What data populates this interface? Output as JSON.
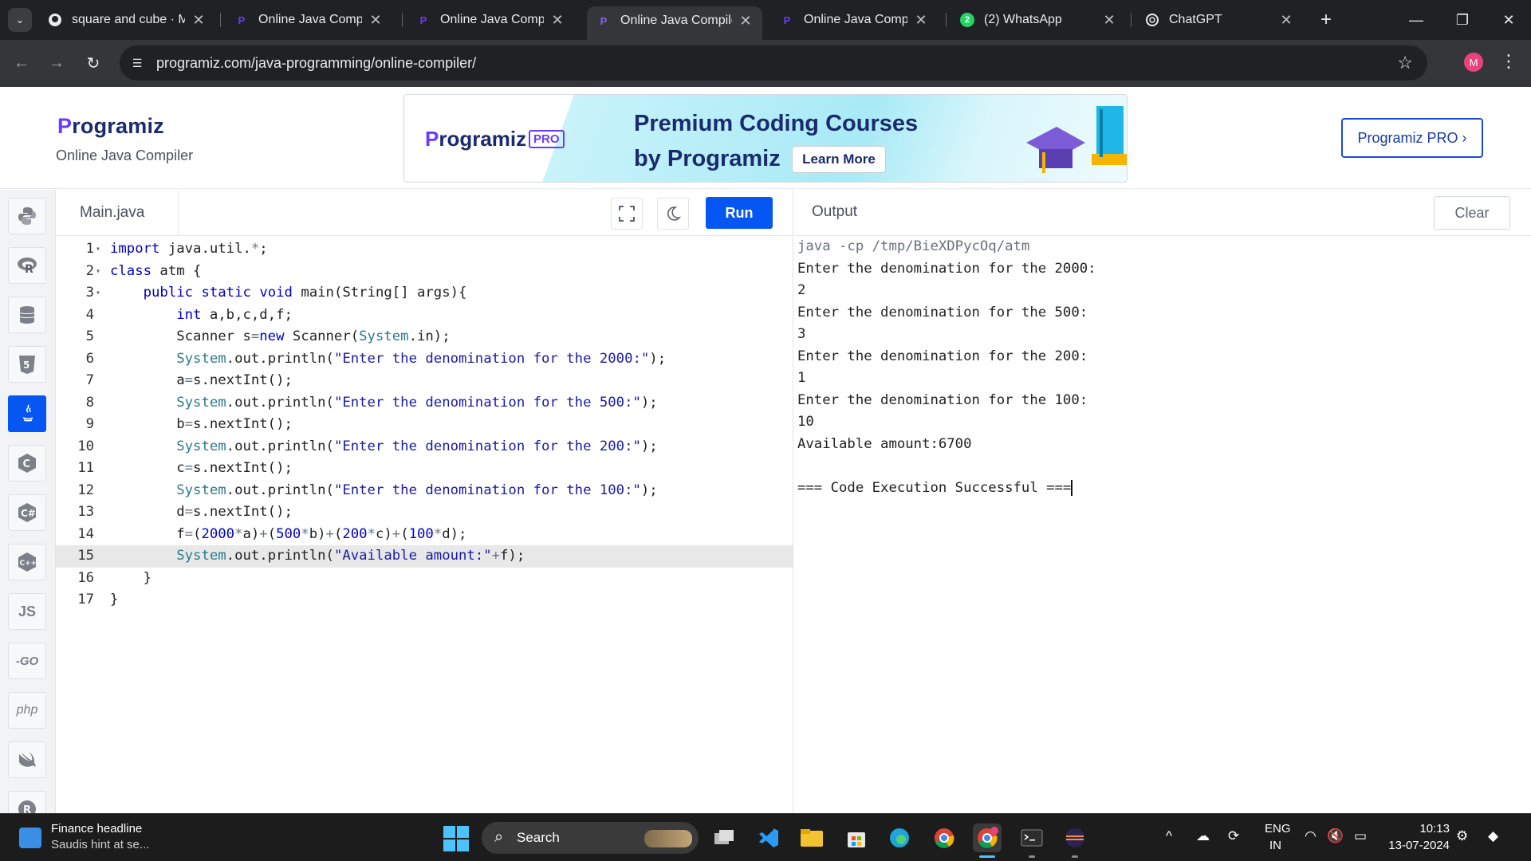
{
  "browser": {
    "tabs": [
      {
        "title": "square and cube · Mc",
        "favicon": "github-icon"
      },
      {
        "title": "Online Java Compiler",
        "favicon": "programiz-icon"
      },
      {
        "title": "Online Java Compiler",
        "favicon": "programiz-icon"
      },
      {
        "title": "Online Java Compiler",
        "favicon": "programiz-icon",
        "active": true
      },
      {
        "title": "Online Java Compiler",
        "favicon": "programiz-icon"
      },
      {
        "title": "(2) WhatsApp",
        "favicon": "whatsapp-icon",
        "badge": "2"
      },
      {
        "title": "ChatGPT",
        "favicon": "chatgpt-icon"
      }
    ],
    "url": "programiz.com/java-programming/online-compiler/",
    "profile_initial": "M"
  },
  "site": {
    "logo_p": "P",
    "logo_rest": "rogramiz",
    "subtitle": "Online Java Compiler",
    "banner": {
      "logo_p": "P",
      "logo_rest": "rogramiz",
      "pro_badge": "PRO",
      "line1": "Premium Coding Courses",
      "line2": "by Programiz",
      "cta": "Learn More"
    },
    "pro_button": "Programiz PRO ›"
  },
  "sidebar": {
    "languages": [
      {
        "name": "python-icon"
      },
      {
        "name": "r-icon"
      },
      {
        "name": "sql-icon"
      },
      {
        "name": "html-icon"
      },
      {
        "name": "java-icon",
        "active": true
      },
      {
        "name": "c-icon"
      },
      {
        "name": "csharp-icon"
      },
      {
        "name": "cpp-icon"
      },
      {
        "name": "js-icon",
        "label": "JS"
      },
      {
        "name": "go-icon",
        "label": "-GO"
      },
      {
        "name": "php-icon",
        "label": "php"
      },
      {
        "name": "swift-icon"
      },
      {
        "name": "rust-icon"
      }
    ]
  },
  "editor": {
    "file_tab": "Main.java",
    "run_label": "Run",
    "active_line": 15,
    "lines": [
      "import java.util.*;",
      "class atm {",
      "    public static void main(String[] args){",
      "        int a,b,c,d,f;",
      "        Scanner s=new Scanner(System.in);",
      "        System.out.println(\"Enter the denomination for the 2000:\");",
      "        a=s.nextInt();",
      "        System.out.println(\"Enter the denomination for the 500:\");",
      "        b=s.nextInt();",
      "        System.out.println(\"Enter the denomination for the 200:\");",
      "        c=s.nextInt();",
      "        System.out.println(\"Enter the denomination for the 100:\");",
      "        d=s.nextInt();",
      "        f=(2000*a)+(500*b)+(200*c)+(100*d);",
      "        System.out.println(\"Available amount:\"+f);",
      "    }",
      "}"
    ],
    "folds": [
      1,
      2,
      3
    ]
  },
  "output": {
    "label": "Output",
    "clear_label": "Clear",
    "lines": [
      "java -cp /tmp/BieXDPycOq/atm",
      "Enter the denomination for the 2000:",
      "2",
      "Enter the denomination for the 500:",
      "3",
      "Enter the denomination for the 200:",
      "1",
      "Enter the denomination for the 100:",
      "10",
      "Available amount:6700",
      "",
      "=== Code Execution Successful ==="
    ]
  },
  "taskbar": {
    "widget_title": "Finance headline",
    "widget_sub": "Saudis hint at se...",
    "search_label": "Search",
    "lang_line1": "ENG",
    "lang_line2": "IN",
    "time": "10:13",
    "date": "13-07-2024"
  }
}
